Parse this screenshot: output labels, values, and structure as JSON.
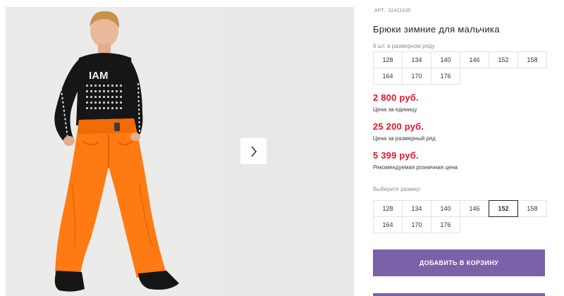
{
  "gallery": {
    "image_alt": "Мальчик в оранжевых зимних брюках",
    "next_icon": "chevron-right-icon"
  },
  "product": {
    "article_label": "АРТ.",
    "article_value": "32411035",
    "title": "Брюки зимние для мальчика",
    "row_note": "9 шт. в размерном ряду",
    "row_sizes": [
      "128",
      "134",
      "140",
      "146",
      "152",
      "158",
      "164",
      "170",
      "176"
    ],
    "prices": [
      {
        "value": "2 800 руб.",
        "note": "Цена за единицу"
      },
      {
        "value": "25 200 руб.",
        "note": "Цена за размерный ряд"
      },
      {
        "value": "5 399 руб.",
        "note": "Рекомендуемая розничная цена"
      }
    ],
    "choose_label": "Выберите размер:",
    "choose_sizes": [
      "128",
      "134",
      "140",
      "146",
      "152",
      "158",
      "164",
      "170",
      "176"
    ],
    "selected_size": "152",
    "add_to_cart": "ДОБАВИТЬ В КОРЗИНУ"
  },
  "colors": {
    "accent": "#7b62a8",
    "price": "#e1172b",
    "pants": "#ff7a12"
  }
}
